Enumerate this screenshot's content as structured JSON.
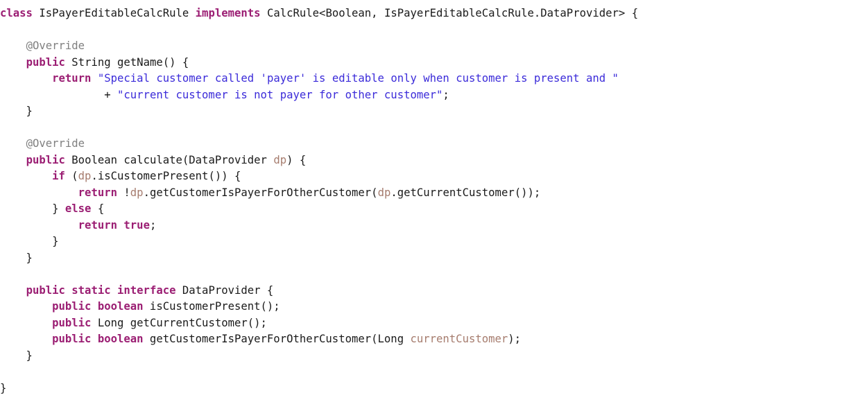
{
  "editor": {
    "language": "Java",
    "background_color": "#ffffff",
    "colors": {
      "keyword": "#9b1e73",
      "string": "#3b2bd9",
      "annotation": "#808080",
      "parameter": "#a67c6e",
      "plain": "#1a1a1a"
    }
  },
  "code": {
    "lines": [
      {
        "n": 1,
        "tokens": [
          {
            "t": "class",
            "k": "kw"
          },
          {
            "t": " IsPayerEditableCalcRule ",
            "k": "plain"
          },
          {
            "t": "implements",
            "k": "kw"
          },
          {
            "t": " CalcRule<Boolean, IsPayerEditableCalcRule.DataProvider> {",
            "k": "plain"
          }
        ]
      },
      {
        "n": 2,
        "tokens": []
      },
      {
        "n": 3,
        "tokens": [
          {
            "t": "    ",
            "k": "plain"
          },
          {
            "t": "@Override",
            "k": "anno"
          }
        ]
      },
      {
        "n": 4,
        "tokens": [
          {
            "t": "    ",
            "k": "plain"
          },
          {
            "t": "public",
            "k": "kw"
          },
          {
            "t": " String getName() {",
            "k": "plain"
          }
        ]
      },
      {
        "n": 5,
        "tokens": [
          {
            "t": "        ",
            "k": "plain"
          },
          {
            "t": "return",
            "k": "kw"
          },
          {
            "t": " ",
            "k": "plain"
          },
          {
            "t": "\"Special customer called 'payer' is editable only when customer is present and \"",
            "k": "str"
          }
        ]
      },
      {
        "n": 6,
        "tokens": [
          {
            "t": "                + ",
            "k": "plain"
          },
          {
            "t": "\"current customer is not payer for other customer\"",
            "k": "str"
          },
          {
            "t": ";",
            "k": "plain"
          }
        ]
      },
      {
        "n": 7,
        "tokens": [
          {
            "t": "    }",
            "k": "plain"
          }
        ]
      },
      {
        "n": 8,
        "tokens": []
      },
      {
        "n": 9,
        "tokens": [
          {
            "t": "    ",
            "k": "plain"
          },
          {
            "t": "@Override",
            "k": "anno"
          }
        ]
      },
      {
        "n": 10,
        "tokens": [
          {
            "t": "    ",
            "k": "plain"
          },
          {
            "t": "public",
            "k": "kw"
          },
          {
            "t": " Boolean calculate(DataProvider ",
            "k": "plain"
          },
          {
            "t": "dp",
            "k": "parm"
          },
          {
            "t": ") {",
            "k": "plain"
          }
        ]
      },
      {
        "n": 11,
        "tokens": [
          {
            "t": "        ",
            "k": "plain"
          },
          {
            "t": "if",
            "k": "kw"
          },
          {
            "t": " (",
            "k": "plain"
          },
          {
            "t": "dp",
            "k": "parm"
          },
          {
            "t": ".isCustomerPresent()) {",
            "k": "plain"
          }
        ]
      },
      {
        "n": 12,
        "tokens": [
          {
            "t": "            ",
            "k": "plain"
          },
          {
            "t": "return",
            "k": "kw"
          },
          {
            "t": " !",
            "k": "plain"
          },
          {
            "t": "dp",
            "k": "parm"
          },
          {
            "t": ".getCustomerIsPayerForOtherCustomer(",
            "k": "plain"
          },
          {
            "t": "dp",
            "k": "parm"
          },
          {
            "t": ".getCurrentCustomer());",
            "k": "plain"
          }
        ]
      },
      {
        "n": 13,
        "tokens": [
          {
            "t": "        } ",
            "k": "plain"
          },
          {
            "t": "else",
            "k": "kw"
          },
          {
            "t": " {",
            "k": "plain"
          }
        ]
      },
      {
        "n": 14,
        "tokens": [
          {
            "t": "            ",
            "k": "plain"
          },
          {
            "t": "return",
            "k": "kw"
          },
          {
            "t": " ",
            "k": "plain"
          },
          {
            "t": "true",
            "k": "kw"
          },
          {
            "t": ";",
            "k": "plain"
          }
        ]
      },
      {
        "n": 15,
        "tokens": [
          {
            "t": "        }",
            "k": "plain"
          }
        ]
      },
      {
        "n": 16,
        "tokens": [
          {
            "t": "    }",
            "k": "plain"
          }
        ]
      },
      {
        "n": 17,
        "tokens": []
      },
      {
        "n": 18,
        "tokens": [
          {
            "t": "    ",
            "k": "plain"
          },
          {
            "t": "public static interface",
            "k": "kw"
          },
          {
            "t": " DataProvider {",
            "k": "plain"
          }
        ]
      },
      {
        "n": 19,
        "tokens": [
          {
            "t": "        ",
            "k": "plain"
          },
          {
            "t": "public boolean",
            "k": "kw"
          },
          {
            "t": " isCustomerPresent();",
            "k": "plain"
          }
        ]
      },
      {
        "n": 20,
        "tokens": [
          {
            "t": "        ",
            "k": "plain"
          },
          {
            "t": "public",
            "k": "kw"
          },
          {
            "t": " Long getCurrentCustomer();",
            "k": "plain"
          }
        ]
      },
      {
        "n": 21,
        "tokens": [
          {
            "t": "        ",
            "k": "plain"
          },
          {
            "t": "public boolean",
            "k": "kw"
          },
          {
            "t": " getCustomerIsPayerForOtherCustomer(Long ",
            "k": "plain"
          },
          {
            "t": "currentCustomer",
            "k": "parm"
          },
          {
            "t": ");",
            "k": "plain"
          }
        ]
      },
      {
        "n": 22,
        "tokens": [
          {
            "t": "    }",
            "k": "plain"
          }
        ]
      },
      {
        "n": 23,
        "tokens": []
      },
      {
        "n": 24,
        "tokens": [
          {
            "t": "}",
            "k": "plain"
          }
        ]
      }
    ]
  }
}
